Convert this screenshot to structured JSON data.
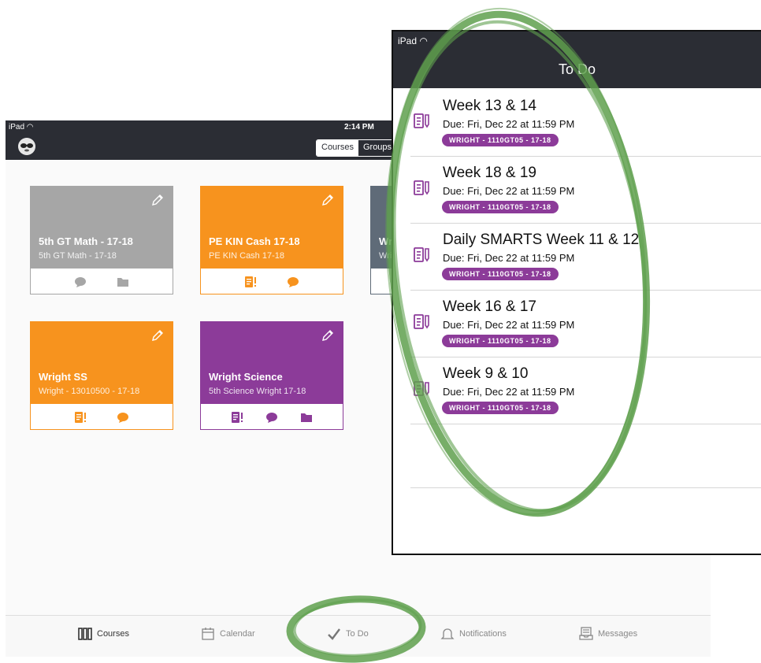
{
  "colors": {
    "dark_bar": "#2b2d34",
    "gray_card": "#a6a6a6",
    "orange_card": "#f7931e",
    "slate_card": "#5f6b78",
    "purple_card": "#8c3b99",
    "badge_purple": "#8c3b99",
    "highlight_green": "#5fa04e"
  },
  "left": {
    "status": {
      "carrier": "iPad",
      "time": "2:14 PM"
    },
    "segmented": {
      "courses": "Courses",
      "groups": "Groups"
    },
    "cards": [
      {
        "title": "5th GT Math - 17-18",
        "subtitle": "5th GT Math - 17-18",
        "icons": [
          "chat-icon",
          "folder-icon"
        ]
      },
      {
        "title": "PE KIN Cash 17-18",
        "subtitle": "PE KIN Cash 17-18",
        "icons": [
          "assignment-alert-icon",
          "chat-icon"
        ]
      },
      {
        "title": "Wr",
        "subtitle": "Wri",
        "icons": []
      },
      {
        "title": "Wright SS",
        "subtitle": "Wright - 13010500 - 17-18",
        "icons": [
          "assignment-alert-icon",
          "chat-icon"
        ]
      },
      {
        "title": "Wright Science",
        "subtitle": "5th Science Wright 17-18",
        "icons": [
          "assignment-alert-icon",
          "chat-icon",
          "folder-icon"
        ]
      }
    ],
    "tabs": [
      {
        "label": "Courses",
        "icon": "courses-icon"
      },
      {
        "label": "Calendar",
        "icon": "calendar-icon"
      },
      {
        "label": "To Do",
        "icon": "check-icon"
      },
      {
        "label": "Notifications",
        "icon": "bell-icon"
      },
      {
        "label": "Messages",
        "icon": "inbox-icon"
      }
    ]
  },
  "right": {
    "status": {
      "carrier": "iPad"
    },
    "title": "To Do",
    "items": [
      {
        "title": "Week 13 & 14",
        "due": "Due: Fri, Dec 22 at 11:59 PM",
        "badge": "WRIGHT - 1110GT05 - 17-18"
      },
      {
        "title": "Week 18 & 19",
        "due": "Due: Fri, Dec 22 at 11:59 PM",
        "badge": "WRIGHT - 1110GT05 - 17-18"
      },
      {
        "title": "Daily SMARTS Week 11 & 12",
        "due": "Due: Fri, Dec 22 at 11:59 PM",
        "badge": "WRIGHT - 1110GT05 - 17-18"
      },
      {
        "title": "Week 16 & 17",
        "due": "Due: Fri, Dec 22 at 11:59 PM",
        "badge": "WRIGHT - 1110GT05 - 17-18"
      },
      {
        "title": "Week 9  & 10",
        "due": "Due: Fri, Dec 22 at 11:59 PM",
        "badge": "WRIGHT - 1110GT05 - 17-18"
      }
    ]
  }
}
